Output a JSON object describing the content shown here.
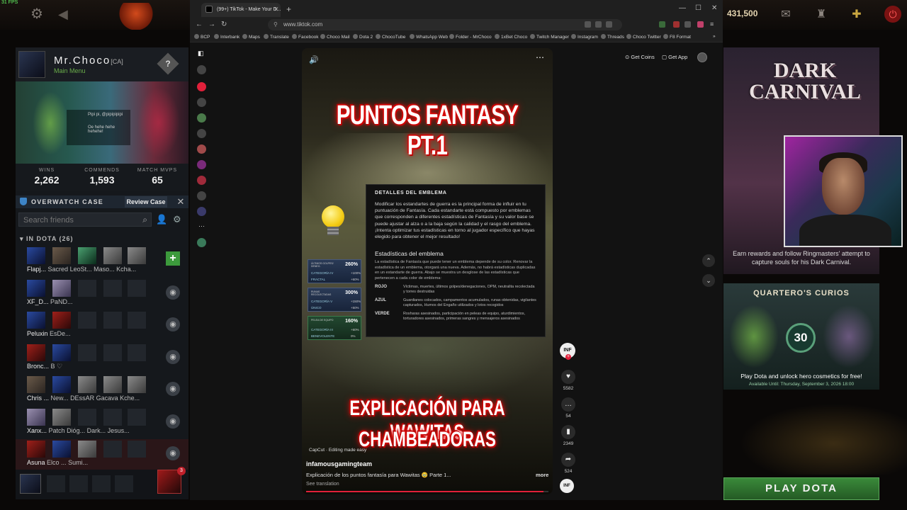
{
  "dota": {
    "fps": "31 FPS",
    "gold": "431,500",
    "profile": {
      "name": "Mr.Choco",
      "tag": "[CA]",
      "status": "Main Menu",
      "help": "?",
      "mini_name": "Pipi pi, @pipipipipi",
      "mini_line": "Oe hehe hehe hehehe!"
    },
    "stats": [
      {
        "label": "WINS",
        "value": "2,262"
      },
      {
        "label": "COMMENDS",
        "value": "1,593"
      },
      {
        "label": "MATCH MVPS",
        "value": "65"
      }
    ],
    "overwatch": {
      "title": "OVERWATCH CASE",
      "button": "Review Case"
    },
    "friends": {
      "search_placeholder": "Search friends",
      "group_label": "IN DOTA (26)",
      "rows": [
        {
          "names": [
            "Flapj...",
            "Sacred",
            "LeoSt...",
            "Maso...",
            "Kcha..."
          ]
        },
        {
          "names": [
            "XF_D...",
            "PaND..."
          ]
        },
        {
          "names": [
            "Peluxin",
            "EsDe..."
          ]
        },
        {
          "names": [
            "Bronc...",
            "B ♡"
          ]
        },
        {
          "names": [
            "Chris ...",
            "New...",
            "DEssAR",
            "Gacava",
            "Kche..."
          ]
        },
        {
          "names": [
            "Xanx...",
            "Patch",
            "Dióg...",
            "Dark...",
            "Jesus..."
          ]
        },
        {
          "names": [
            "Asuna",
            "Elco ...",
            "Sumi..."
          ]
        }
      ]
    },
    "notif_count": "3",
    "dark_carnival": {
      "logo_line1": "DARK",
      "logo_line2": "CARNIVAL",
      "text": "Earn rewards and follow Ringmasters' attempt to capture souls for his Dark Carnival."
    },
    "curios": {
      "title": "QUARTERO'S CURIOS",
      "badge": "30",
      "text": "Play Dota and unlock hero cosmetics for free!",
      "available": "Available Until:  Thursday, September 3, 2026 18:00"
    },
    "play_button": "PLAY DOTA"
  },
  "browser": {
    "tab_title": "(99+) TikTok - Make Your D...",
    "url": "www.tiktok.com",
    "bookmarks": [
      "BCP",
      "Interbank",
      "Maps",
      "Translate",
      "Facebook",
      "Choco Mail",
      "Dota 2",
      "ChocoTube",
      "WhatsApp Web",
      "Folder - MrChoco",
      "1xBet Choco",
      "Twitch Manager",
      "Instagram",
      "Threads",
      "Choco Twitter",
      "F8 Format"
    ]
  },
  "tiktok": {
    "get_coins": "Get Coins",
    "get_app": "Get App",
    "video_title": "PUNTOS FANTASY PT.1",
    "panel_heading": "DETALLES DEL EMBLEMA",
    "panel_text": "Modificar los estandartes de guerra es la principal forma de influir en tu puntuación de Fantasía. Cada estandarte está compuesto por emblemas que corresponden a diferentes estadísticas de Fantasía y su valor base se puede ajustar al alza o a la baja según la calidad y el rasgo del emblema. ¡Intenta optimizar tus estadísticas en torno al jugador específico que hayas elegido para obtener el mejor resultado!",
    "stats_heading": "Estadísticas del emblema",
    "stats_text": "La estadística de Fantasía que puede tener un emblema depende de su color. Renovar la estadística de un emblema, otorgará una nueva. Además, no habrá estadísticas duplicadas en un estandarte de guerra. Abajo se muestra un desglose de las estadísticas que pertenecen a cada color de emblema:",
    "colors": [
      {
        "name": "ROJO",
        "text": "Víctimas, muertes, últimos golpes/denegaciones, OPM, neutralita recolectada y torres destruidas"
      },
      {
        "name": "AZUL",
        "text": "Guardianes colocados, campamentos acumulados, runas obtenidas, vigilantes capturados, Humos del Engaño utilizados y lotos recogidos"
      },
      {
        "name": "VERDE",
        "text": "Rosharas asesinados, participación en peleas de equipo, aturdimientos, torturadores asesinados, primeras sangres y mensajeros asesinados"
      }
    ],
    "cards": [
      {
        "label": "ÚLTIMOS GOLPES/ DENEG.",
        "pct": "260%",
        "r1": "CATEGORÍA IV",
        "r1v": "+100%",
        "r2": "FRACTAL",
        "r2v": "+60%"
      },
      {
        "label": "RUNAS RECOLECTADAS",
        "pct": "300%",
        "r1": "CATEGORÍA V",
        "r1v": "+150%",
        "r2": "ÚNICO",
        "r2v": "+50%"
      },
      {
        "label": "PELEA DE EQUIPO",
        "pct": "160%",
        "r1": "CATEGORÍA III",
        "r1v": "+60%",
        "r2": "BENEVOLENTE",
        "r2v": "0%"
      }
    ],
    "subtitle_line1": "EXPLICACIÓN PARA WAWITAS",
    "subtitle_line2": "CHAMBEADORAS",
    "capcut": "CapCut · Editing made easy",
    "username": "infamousgamingteam",
    "description": "Explicación de los puntos fantasía para Wawitas 🥹 Parte 1...",
    "more": "more",
    "see_translation": "See translation",
    "creator_initials": "INF",
    "likes": "5582",
    "comments": "54",
    "saves": "2349",
    "shares": "524",
    "progress": 0.98
  }
}
